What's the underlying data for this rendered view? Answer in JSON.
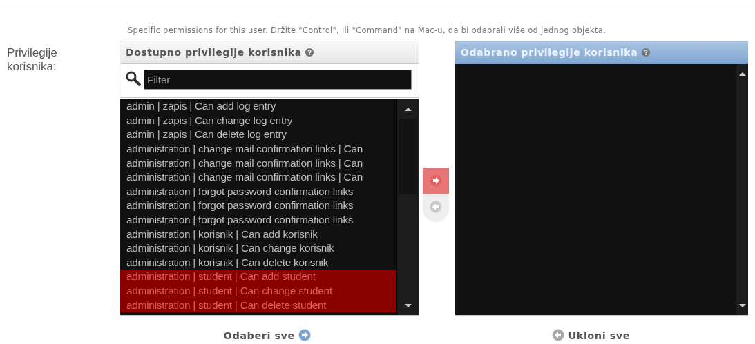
{
  "help_text": "Specific permissions for this user. Držite \"Control\", ili \"Command\" na Mac-u, da bi odabrali više od jednog objekta.",
  "field_label": "Privilegije korisnika:",
  "available": {
    "title": "Dostupno privilegije korisnika",
    "filter": {
      "placeholder": "Filter"
    },
    "options": [
      {
        "label": "admin | zapis | Can add log entry",
        "selected": false
      },
      {
        "label": "admin | zapis | Can change log entry",
        "selected": false
      },
      {
        "label": "admin | zapis | Can delete log entry",
        "selected": false
      },
      {
        "label": "administration | change mail confirmation links | Can",
        "selected": false
      },
      {
        "label": "administration | change mail confirmation links | Can",
        "selected": false
      },
      {
        "label": "administration | change mail confirmation links | Can",
        "selected": false
      },
      {
        "label": "administration | forgot password confirmation links",
        "selected": false
      },
      {
        "label": "administration | forgot password confirmation links",
        "selected": false
      },
      {
        "label": "administration | forgot password confirmation links",
        "selected": false
      },
      {
        "label": "administration | korisnik | Can add korisnik",
        "selected": false
      },
      {
        "label": "administration | korisnik | Can change korisnik",
        "selected": false
      },
      {
        "label": "administration | korisnik | Can delete korisnik",
        "selected": false
      },
      {
        "label": "administration | student | Can add student",
        "selected": true
      },
      {
        "label": "administration | student | Can change student",
        "selected": true
      },
      {
        "label": "administration | student | Can delete student",
        "selected": true
      }
    ],
    "choose_all": "Odaberi sve"
  },
  "movers": [
    {
      "kind": "add",
      "active": true
    },
    {
      "kind": "remove",
      "active": false
    }
  ],
  "chosen": {
    "title": "Odabrano privilegije korisnika",
    "remove_all": "Ukloni sve"
  }
}
